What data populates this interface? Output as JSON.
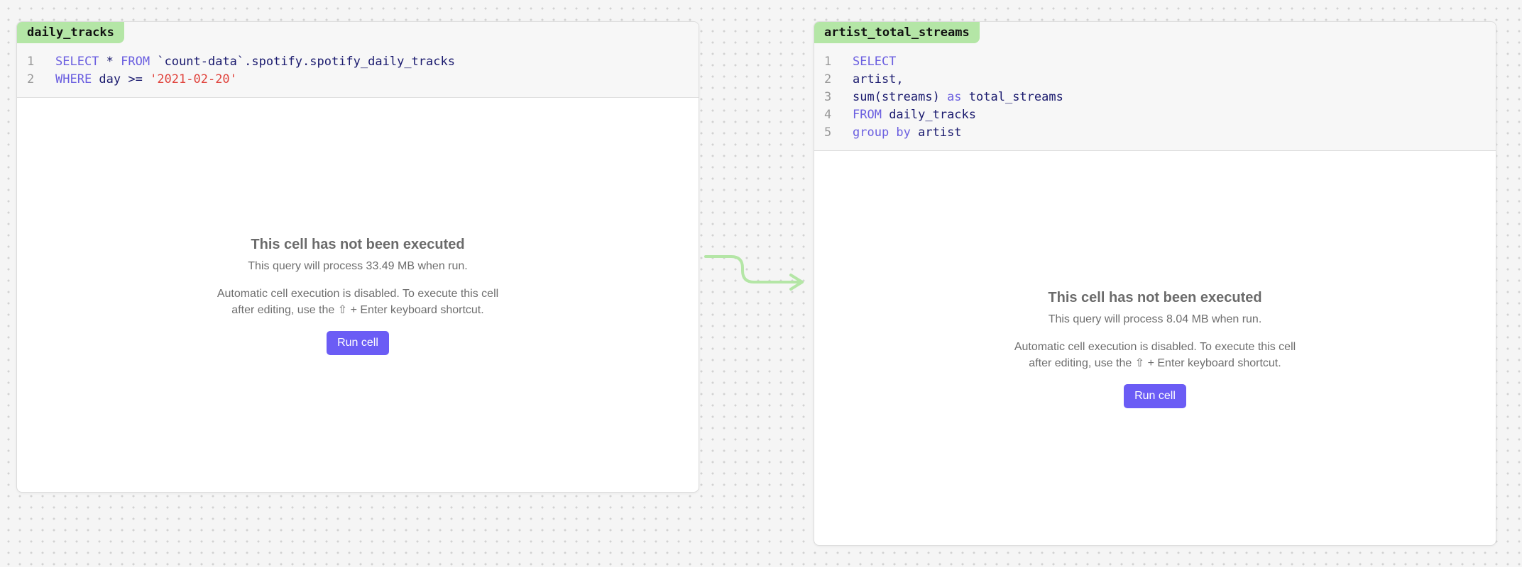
{
  "cells": [
    {
      "name": "daily_tracks",
      "code": [
        {
          "n": "1",
          "tokens": [
            {
              "t": "SELECT",
              "c": "kw"
            },
            {
              "t": " * ",
              "c": "id"
            },
            {
              "t": "FROM",
              "c": "kw"
            },
            {
              "t": " `count-data`.spotify.spotify_daily_tracks",
              "c": "id"
            }
          ]
        },
        {
          "n": "2",
          "tokens": [
            {
              "t": "WHERE",
              "c": "kw"
            },
            {
              "t": " day >= ",
              "c": "id"
            },
            {
              "t": "'2021-02-20'",
              "c": "str"
            }
          ]
        }
      ],
      "status_title": "This cell has not been executed",
      "status_sub": "This query will process 33.49 MB when run.",
      "status_msg": "Automatic cell execution is disabled. To execute this cell after editing, use the ⇧ + Enter keyboard shortcut.",
      "run_label": "Run cell"
    },
    {
      "name": "artist_total_streams",
      "code": [
        {
          "n": "1",
          "tokens": [
            {
              "t": "SELECT",
              "c": "kw"
            }
          ]
        },
        {
          "n": "2",
          "tokens": [
            {
              "t": "artist,",
              "c": "id"
            }
          ]
        },
        {
          "n": "3",
          "tokens": [
            {
              "t": "sum(streams) ",
              "c": "id"
            },
            {
              "t": "as",
              "c": "kw"
            },
            {
              "t": " total_streams",
              "c": "id"
            }
          ]
        },
        {
          "n": "4",
          "tokens": [
            {
              "t": "FROM",
              "c": "kw"
            },
            {
              "t": " daily_tracks",
              "c": "id"
            }
          ]
        },
        {
          "n": "5",
          "tokens": [
            {
              "t": "group by",
              "c": "kw"
            },
            {
              "t": " artist",
              "c": "id"
            }
          ]
        }
      ],
      "status_title": "This cell has not been executed",
      "status_sub": "This query will process 8.04 MB when run.",
      "status_msg": "Automatic cell execution is disabled. To execute this cell after editing, use the ⇧ + Enter keyboard shortcut.",
      "run_label": "Run cell"
    }
  ],
  "colors": {
    "tag_bg": "#b4e6a6",
    "keyword": "#6a5ee0",
    "identifier": "#1a1a6e",
    "string": "#e0433c",
    "run_button": "#6b5cf5",
    "edge": "#b4e6a6"
  }
}
